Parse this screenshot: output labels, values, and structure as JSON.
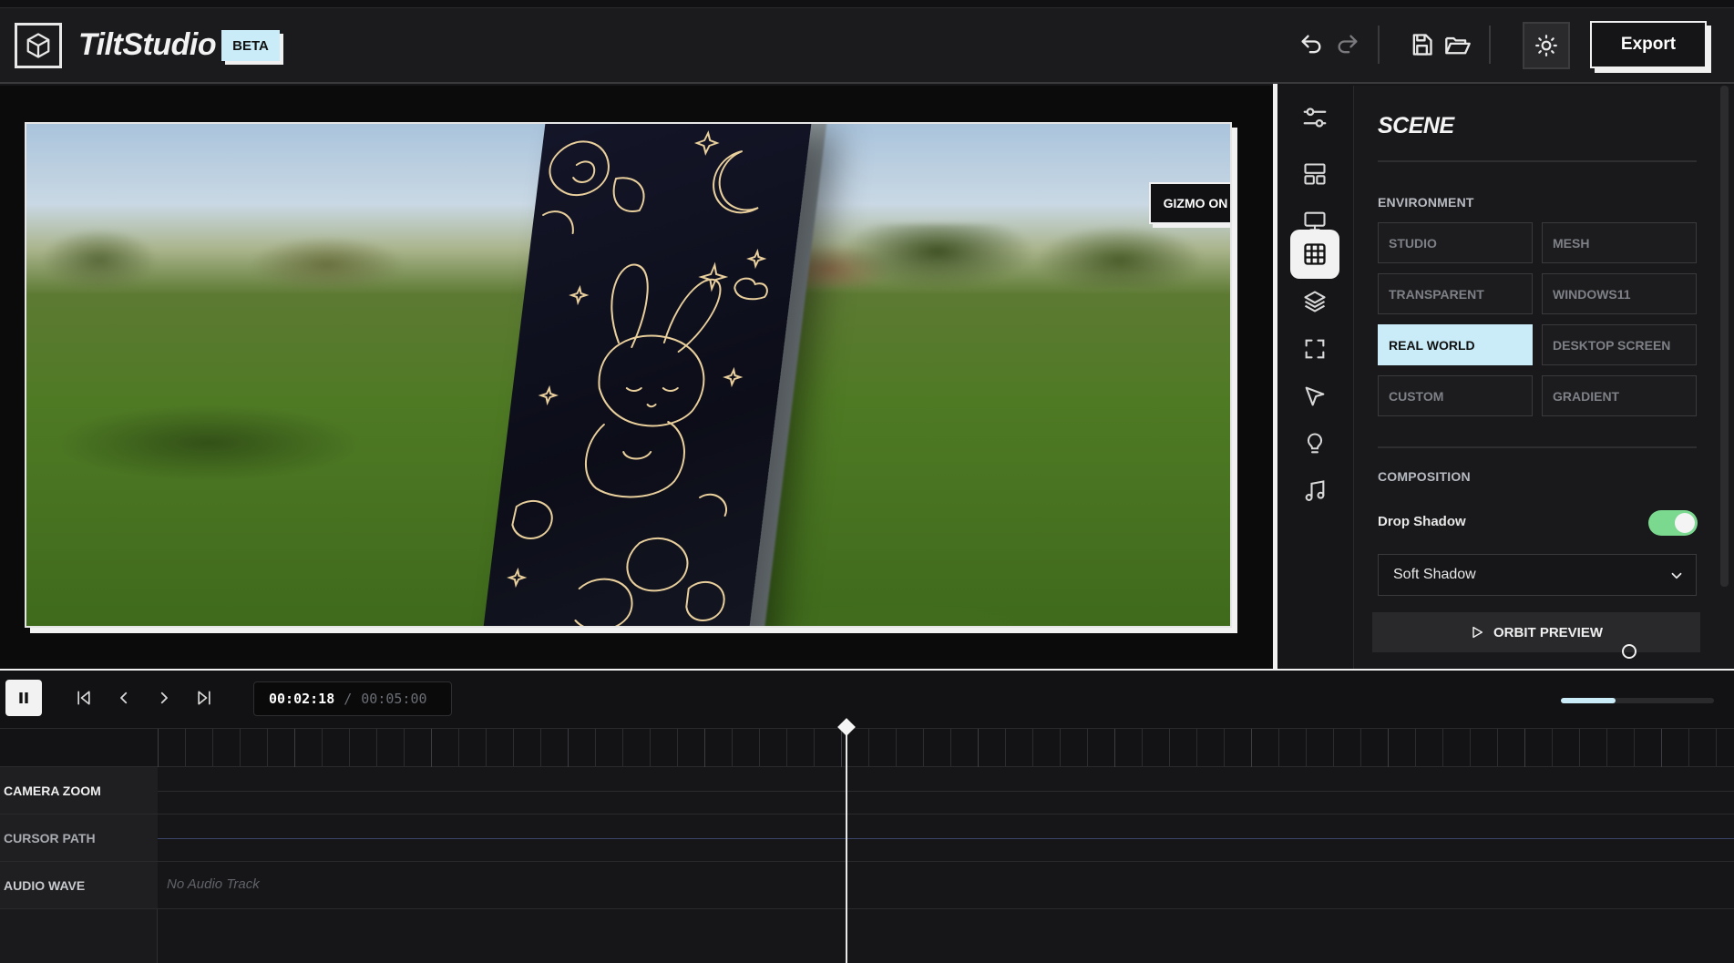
{
  "header": {
    "app_title": "TiltStudio",
    "beta_badge": "BETA",
    "export_label": "Export"
  },
  "canvas": {
    "gizmo_label": "GIZMO ON"
  },
  "rail": {
    "items": [
      "adjustments-icon",
      "layout-icon",
      "monitor-icon",
      "grid-icon",
      "layers-icon",
      "frame-icon",
      "cursor-icon",
      "bulb-icon",
      "music-icon"
    ],
    "active_index": 3
  },
  "panel": {
    "title": "SCENE",
    "environment_label": "ENVIRONMENT",
    "environment_options": [
      "STUDIO",
      "MESH",
      "TRANSPARENT",
      "WINDOWS11",
      "REAL WORLD",
      "DESKTOP SCREEN",
      "CUSTOM",
      "GRADIENT"
    ],
    "environment_selected": "REAL WORLD",
    "composition_label": "COMPOSITION",
    "drop_shadow_label": "Drop Shadow",
    "drop_shadow_on": true,
    "shadow_style": "Soft Shadow",
    "orbit_label": "ORBIT PREVIEW"
  },
  "transport": {
    "current_time": "00:02:18",
    "separator": "/",
    "total_time": "00:05:00",
    "zoom_level": 0.36
  },
  "timeline": {
    "tracks": [
      {
        "label": "CAMERA ZOOM"
      },
      {
        "label": "CURSOR PATH"
      },
      {
        "label": "AUDIO WAVE",
        "placeholder": "No Audio Track"
      }
    ]
  },
  "colors": {
    "accent": "#c9ecf8",
    "toggle_on": "#7bd88f",
    "background": "#161618"
  }
}
